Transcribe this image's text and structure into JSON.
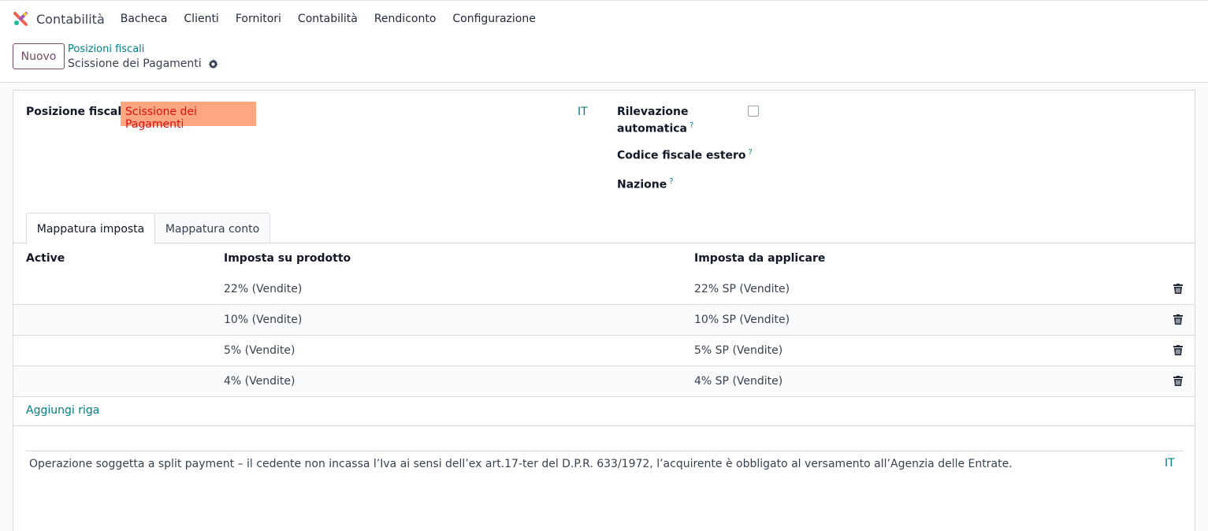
{
  "app": {
    "name": "Contabilità",
    "brand_colors": {
      "primary": "#714b67",
      "link": "#017e84"
    }
  },
  "navbar": {
    "items": [
      "Bacheca",
      "Clienti",
      "Fornitori",
      "Contabilità",
      "Rendiconto",
      "Configurazione"
    ]
  },
  "control_panel": {
    "new_button": "Nuovo",
    "breadcrumb_parent": "Posizioni fiscali",
    "breadcrumb_current": "Scissione dei Pagamenti",
    "gear_icon": "gear-icon"
  },
  "form": {
    "fiscal_position_label": "Posizione fiscale",
    "fiscal_position_value": "Scissione dei Pagamenti",
    "lang_code": "IT",
    "auto_detect_label_line1": "Rilevazione",
    "auto_detect_label_line2": "automatica",
    "auto_detect_checked": false,
    "foreign_vat_label": "Codice fiscale estero",
    "country_label": "Nazione",
    "help_mark": "?"
  },
  "tabs": [
    {
      "label": "Mappatura imposta",
      "active": true
    },
    {
      "label": "Mappatura conto",
      "active": false
    }
  ],
  "tax_table": {
    "columns": [
      "Active",
      "Imposta su prodotto",
      "Imposta da applicare"
    ],
    "rows": [
      {
        "product_tax": "22% (Vendite)",
        "applied_tax": "22% SP (Vendite)"
      },
      {
        "product_tax": "10% (Vendite)",
        "applied_tax": "10% SP (Vendite)"
      },
      {
        "product_tax": "5% (Vendite)",
        "applied_tax": "5% SP (Vendite)"
      },
      {
        "product_tax": "4% (Vendite)",
        "applied_tax": "4% SP (Vendite)"
      }
    ],
    "add_line": "Aggiungi riga",
    "row_action_icon": "trash-icon"
  },
  "note": {
    "text": "Operazione soggetta a split payment – il cedente non incassa l’Iva ai sensi dell’ex art.17-ter del D.P.R. 633/1972, l’acquirente è obbligato al versamento all’Agenzia delle Entrate.",
    "lang_code": "IT"
  }
}
